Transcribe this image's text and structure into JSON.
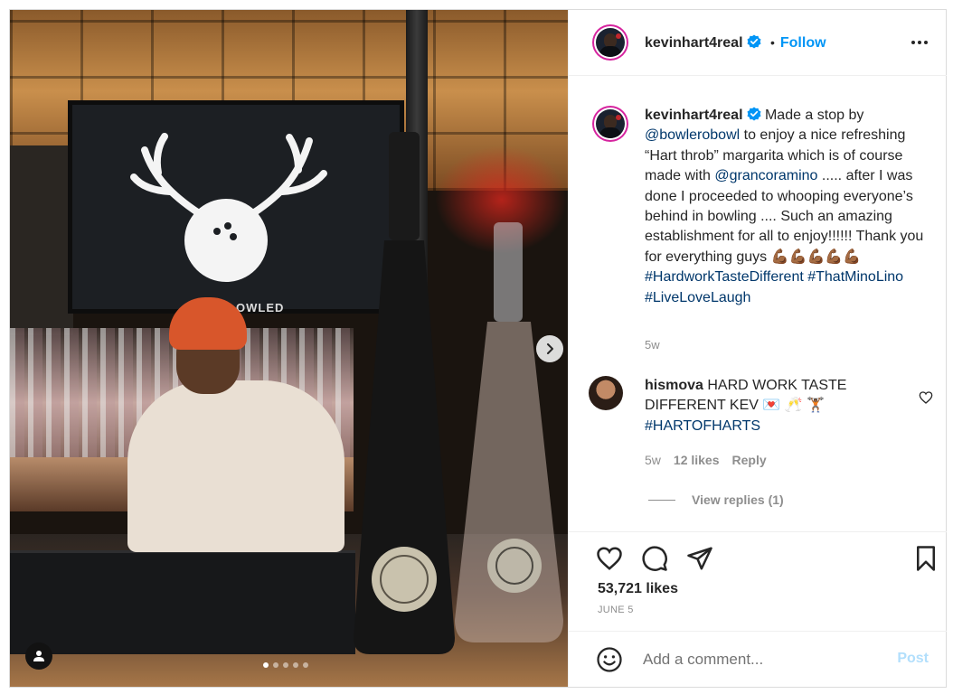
{
  "header": {
    "username": "kevinhart4real",
    "separator": "•",
    "follow_label": "Follow"
  },
  "caption": {
    "username": "kevinhart4real",
    "text_1": " Made a stop by ",
    "mention_1": "@bowlerobowl",
    "text_2": " to enjoy a nice refreshing “Hart throb” margarita which is of course made with ",
    "mention_2": "@grancoramino",
    "text_3": " ..... after I was done I proceeded to whooping everyone’s behind in bowling .... Such an amazing establishment for all to enjoy!!!!!! Thank you for everything guys 💪🏾💪🏾💪🏾💪🏾💪🏾 ",
    "hashtag_1": "#HardworkTasteDifferent",
    "hashtag_2": "#ThatMinoLino",
    "hashtag_3": "#LiveLoveLaugh",
    "time": "5w"
  },
  "comment": {
    "username": "hismova",
    "text": " HARD WORK TASTE DIFFERENT KEV 💌 🥂 🏋🏾 ",
    "hashtag": "#HARTOFHARTS",
    "time": "5w",
    "likes": "12 likes",
    "reply_label": "Reply",
    "view_replies": "View replies (1)"
  },
  "media": {
    "tv_text": "OWLED",
    "carousel_dots": 5,
    "active_dot": 0
  },
  "actions": {
    "likes": "53,721 likes",
    "date": "JUNE 5"
  },
  "add_comment": {
    "placeholder": "Add a comment...",
    "post_label": "Post"
  },
  "colors": {
    "link": "#00376b",
    "follow": "#0095f6",
    "post_disabled": "#b2dffc",
    "verified": "#0095f6"
  }
}
